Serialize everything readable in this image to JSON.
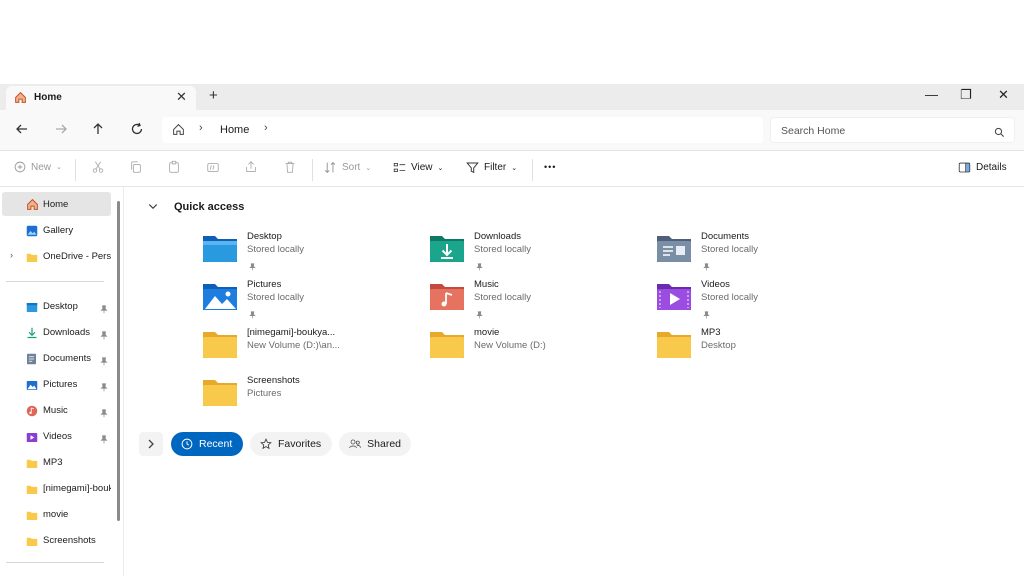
{
  "tab": {
    "title": "Home",
    "close": "✕",
    "new_tab": "+"
  },
  "window_controls": {
    "minimize": "—",
    "restore": "❐",
    "close": "✕"
  },
  "address": {
    "crumb": "Home",
    "separator": "›"
  },
  "search": {
    "placeholder": "Search Home"
  },
  "toolbar": {
    "new_label": "New",
    "sort_label": "Sort",
    "view_label": "View",
    "filter_label": "Filter",
    "more_label": "•••",
    "details_label": "Details"
  },
  "sidebar": {
    "top_items": [
      {
        "label": "Home"
      },
      {
        "label": "Gallery"
      },
      {
        "label": "OneDrive - Personal"
      }
    ],
    "pinned_items": [
      {
        "label": "Desktop"
      },
      {
        "label": "Downloads"
      },
      {
        "label": "Documents"
      },
      {
        "label": "Pictures"
      },
      {
        "label": "Music"
      },
      {
        "label": "Videos"
      },
      {
        "label": "MP3"
      },
      {
        "label": "[nimegami]-boukyaku"
      },
      {
        "label": "movie"
      },
      {
        "label": "Screenshots"
      }
    ]
  },
  "quick_access": {
    "title": "Quick access",
    "items": [
      {
        "name": "Desktop",
        "sub": "Stored locally"
      },
      {
        "name": "Downloads",
        "sub": "Stored locally"
      },
      {
        "name": "Documents",
        "sub": "Stored locally"
      },
      {
        "name": "Pictures",
        "sub": "Stored locally"
      },
      {
        "name": "Music",
        "sub": "Stored locally"
      },
      {
        "name": "Videos",
        "sub": "Stored locally"
      },
      {
        "name": "[nimegami]-boukya...",
        "sub": "New Volume (D:)\\an..."
      },
      {
        "name": "movie",
        "sub": "New Volume (D:)"
      },
      {
        "name": "MP3",
        "sub": "Desktop"
      },
      {
        "name": "Screenshots",
        "sub": "Pictures"
      }
    ]
  },
  "filters": {
    "recent": "Recent",
    "favorites": "Favorites",
    "shared": "Shared"
  },
  "colors": {
    "accent": "#0067c0",
    "folder": "#f8c94a",
    "selected": "#e5e5e5"
  }
}
